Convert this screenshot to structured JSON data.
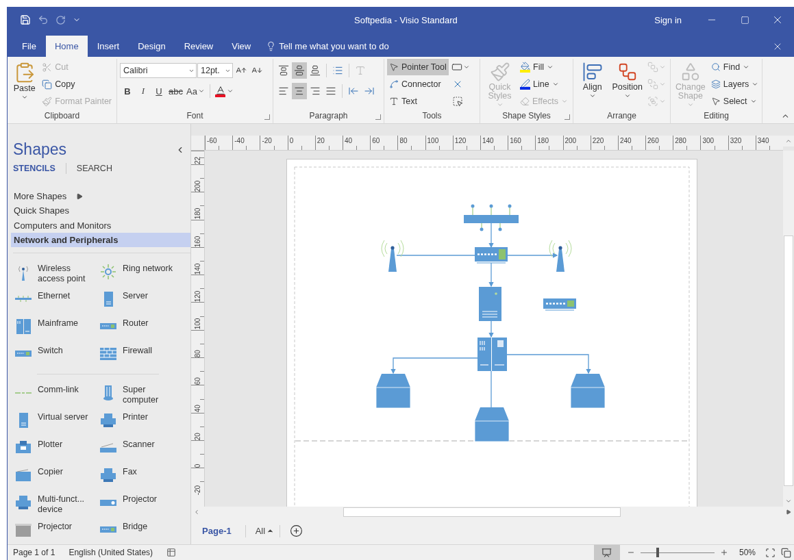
{
  "window": {
    "title": "Softpedia - Visio Standard",
    "sign_in": "Sign in"
  },
  "menu_tabs": [
    {
      "label": "File",
      "selected": false
    },
    {
      "label": "Home",
      "selected": true
    },
    {
      "label": "Insert",
      "selected": false
    },
    {
      "label": "Design",
      "selected": false
    },
    {
      "label": "Review",
      "selected": false
    },
    {
      "label": "View",
      "selected": false
    }
  ],
  "tell_me": {
    "placeholder": "Tell me what you want to do"
  },
  "ribbon": {
    "clipboard": {
      "label": "Clipboard",
      "paste": "Paste",
      "buttons": [
        {
          "label": "Cut",
          "disabled": true
        },
        {
          "label": "Copy",
          "disabled": false
        },
        {
          "label": "Format Painter",
          "disabled": true
        }
      ]
    },
    "font": {
      "label": "Font",
      "font": "Calibri",
      "size": "12pt.",
      "formats": [
        "B",
        "I",
        "U",
        "abc",
        "Aa"
      ]
    },
    "paragraph": {
      "label": "Paragraph",
      "vertical_align": [
        {
          "selected": false
        },
        {
          "selected": true
        },
        {
          "selected": false
        }
      ],
      "horizontal_align": [
        {
          "selected": false
        },
        {
          "selected": true
        },
        {
          "selected": false
        },
        {
          "selected": false
        }
      ]
    },
    "tools": {
      "label": "Tools",
      "tools": [
        {
          "label": "Pointer Tool",
          "selected": true
        },
        {
          "label": "Connector",
          "selected": false
        },
        {
          "label": "Text",
          "selected": false
        }
      ]
    },
    "shape_styles": {
      "label": "Shape Styles",
      "quick_styles": {
        "label": "Quick Styles",
        "disabled": true
      },
      "buttons": [
        {
          "label": "Fill",
          "disabled": false
        },
        {
          "label": "Line",
          "disabled": false
        },
        {
          "label": "Effects",
          "disabled": true
        }
      ]
    },
    "arrange": {
      "label": "Arrange",
      "buttons": [
        "Align",
        "Position"
      ]
    },
    "editing": {
      "label": "Editing",
      "change_shape": {
        "label": "Change Shape",
        "disabled": true
      },
      "buttons": [
        "Find",
        "Layers",
        "Select"
      ]
    }
  },
  "shapes_panel": {
    "title": "Shapes",
    "tabs": [
      {
        "label": "STENCILS",
        "selected": true
      },
      {
        "label": "SEARCH",
        "selected": false
      }
    ],
    "stencils": [
      {
        "label": "More Shapes",
        "kind": "submenu",
        "selected": false
      },
      {
        "label": "Quick Shapes",
        "kind": "stencil",
        "selected": false
      },
      {
        "label": "Computers and Monitors",
        "kind": "stencil",
        "selected": false
      },
      {
        "label": "Network and Peripherals",
        "kind": "stencil",
        "selected": true
      }
    ],
    "sections": [
      [
        {
          "label": "Wireless access point"
        },
        {
          "label": "Ring network"
        },
        {
          "label": "Ethernet"
        },
        {
          "label": "Server"
        },
        {
          "label": "Mainframe"
        },
        {
          "label": "Router"
        },
        {
          "label": "Switch"
        },
        {
          "label": "Firewall"
        }
      ],
      [
        {
          "label": "Comm-link"
        },
        {
          "label": "Super computer"
        },
        {
          "label": "Virtual server"
        },
        {
          "label": "Printer"
        },
        {
          "label": "Plotter"
        },
        {
          "label": "Scanner"
        },
        {
          "label": "Copier"
        },
        {
          "label": "Fax"
        },
        {
          "label": "Multi-funct... device"
        },
        {
          "label": "Projector"
        },
        {
          "label": "Projector"
        },
        {
          "label": "Bridge"
        }
      ]
    ]
  },
  "rulers": {
    "horizontal": [
      "-60",
      "-40",
      "-20",
      "0",
      "20",
      "40",
      "60",
      "80",
      "100",
      "120",
      "140",
      "160",
      "180",
      "200",
      "220",
      "240",
      "260",
      "280",
      "300",
      "320",
      "340"
    ],
    "vertical": [
      "22",
      "200",
      "180",
      "160",
      "140",
      "120",
      "100",
      "80",
      "60",
      "40",
      "20",
      "0",
      "-20"
    ]
  },
  "page_tabs": [
    {
      "label": "Page-1",
      "selected": true
    }
  ],
  "all_pages": "All",
  "status_bar": {
    "page": "Page 1 of 1",
    "language": "English (United States)",
    "zoom": {
      "level": 0.23,
      "reading": "50%"
    }
  }
}
